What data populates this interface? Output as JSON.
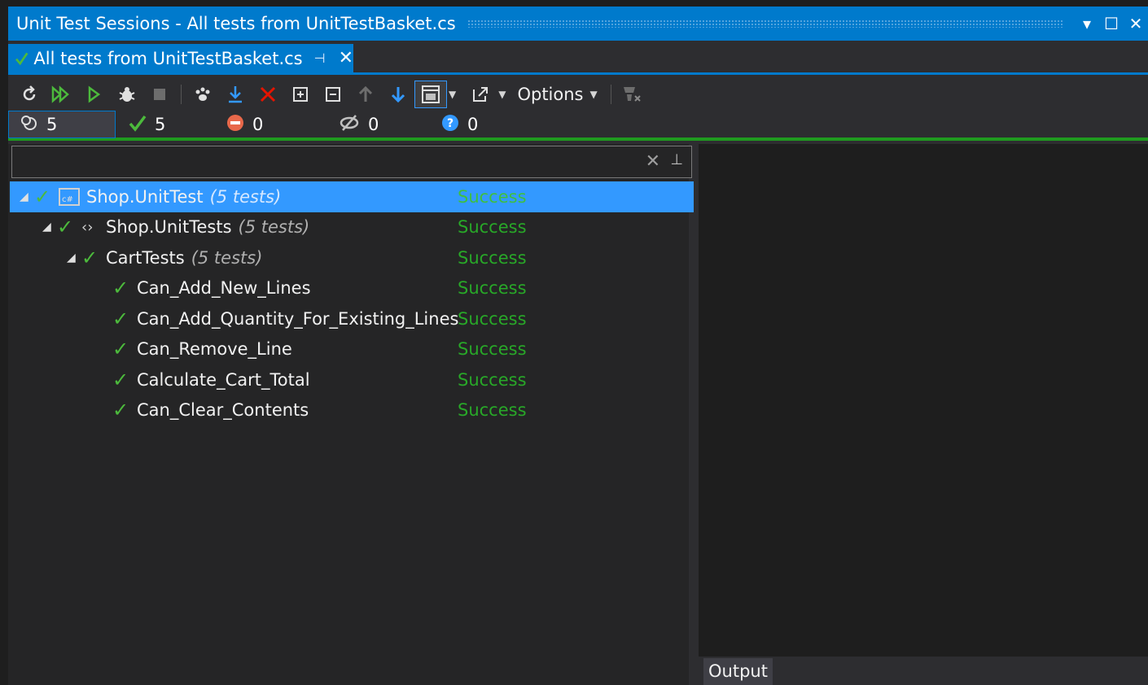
{
  "window": {
    "title": "Unit Test Sessions - All tests from UnitTestBasket.cs",
    "menu_glyph": "▾",
    "maximize_glyph": "☐",
    "close_glyph": "✕"
  },
  "tab": {
    "label": "All tests from UnitTestBasket.cs",
    "check_glyph": "✓",
    "pin_glyph": "⊣",
    "close_glyph": "✕"
  },
  "toolbar": {
    "options_label": "Options"
  },
  "counts": {
    "total": "5",
    "passed": "5",
    "failed": "0",
    "ignored": "0",
    "unknown": "0"
  },
  "search": {
    "value": "",
    "clear_glyph": "✕",
    "pin_glyph": "⊥"
  },
  "tree": [
    {
      "name": "Shop.UnitTest",
      "count": "(5 tests)",
      "status": "Success"
    },
    {
      "name": "Shop.UnitTests",
      "count": "(5 tests)",
      "status": "Success"
    },
    {
      "name": "CartTests",
      "count": "(5 tests)",
      "status": "Success"
    },
    {
      "name": "Can_Add_New_Lines",
      "status": "Success"
    },
    {
      "name": "Can_Add_Quantity_For_Existing_Lines",
      "status": "Success"
    },
    {
      "name": "Can_Remove_Line",
      "status": "Success"
    },
    {
      "name": "Calculate_Cart_Total",
      "status": "Success"
    },
    {
      "name": "Can_Clear_Contents",
      "status": "Success"
    }
  ],
  "output": {
    "tab_label": "Output"
  },
  "colors": {
    "accent": "#007acc",
    "success": "#28a828",
    "selection": "#3399ff"
  }
}
